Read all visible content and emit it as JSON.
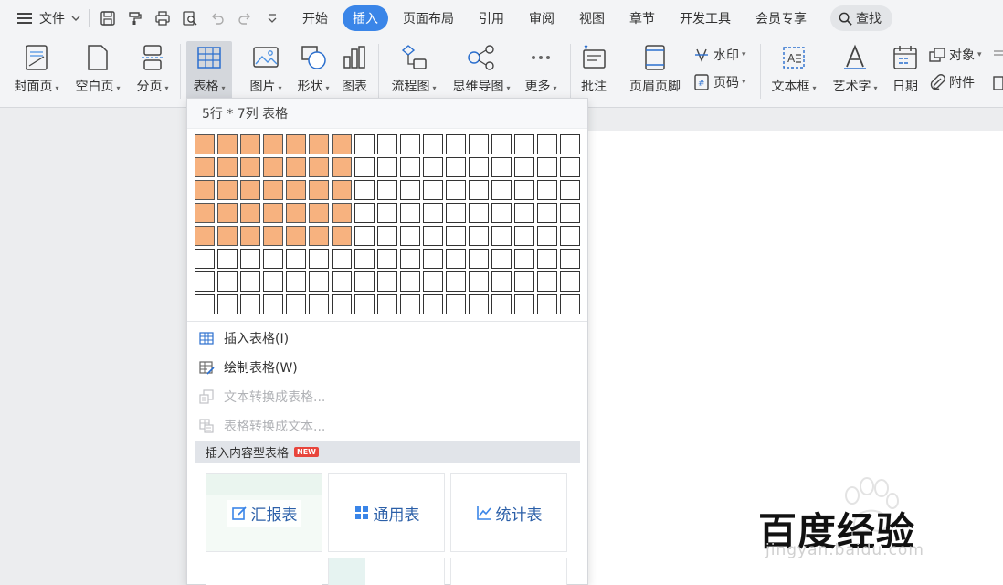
{
  "menubar": {
    "file_label": "文件",
    "tabs": [
      "开始",
      "插入",
      "页面布局",
      "引用",
      "审阅",
      "视图",
      "章节",
      "开发工具",
      "会员专享"
    ],
    "active_tab": "插入",
    "search_label": "查找"
  },
  "ribbon": {
    "cover_page": "封面页",
    "blank_page": "空白页",
    "page_break": "分页",
    "table": "表格",
    "picture": "图片",
    "shape": "形状",
    "chart": "图表",
    "flowchart": "流程图",
    "mindmap": "思维导图",
    "more": "更多",
    "comment": "批注",
    "header_footer": "页眉页脚",
    "watermark": "水印",
    "page_number": "页码",
    "textbox": "文本框",
    "wordart": "艺术字",
    "date": "日期",
    "object": "对象",
    "attachment": "附件"
  },
  "table_menu": {
    "grid_label": "5行 * 7列 表格",
    "grid_rows": 8,
    "grid_cols": 17,
    "selected_rows": 5,
    "selected_cols": 7,
    "selected_color": "#f7b27f",
    "items": [
      {
        "label": "插入表格(I)",
        "enabled": true,
        "icon": "insert-table-icon"
      },
      {
        "label": "绘制表格(W)",
        "enabled": true,
        "icon": "draw-table-icon"
      },
      {
        "label": "文本转换成表格...",
        "enabled": false,
        "icon": "text-to-table-icon"
      },
      {
        "label": "表格转换成文本...",
        "enabled": false,
        "icon": "table-to-text-icon"
      }
    ],
    "content_header": "插入内容型表格",
    "new_badge": "NEW",
    "templates": [
      "汇报表",
      "通用表",
      "统计表"
    ]
  },
  "watermark": {
    "main": "百度经验",
    "sub": "jingyan.baidu.com"
  },
  "colors": {
    "accent": "#3a85e8",
    "link": "#2b5fa8"
  }
}
